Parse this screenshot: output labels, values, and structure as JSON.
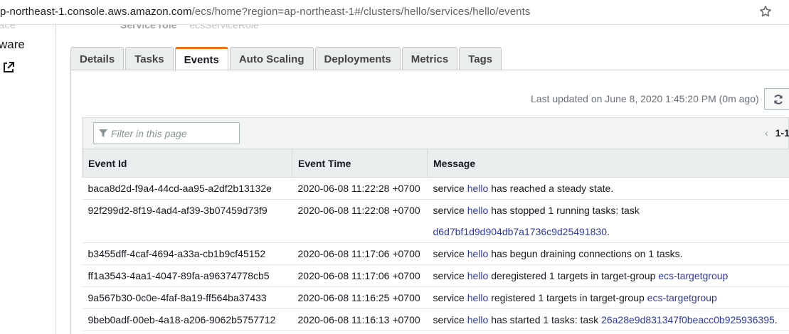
{
  "browser": {
    "url_host_partial": "p-northeast-1.console.aws.amazon.com",
    "url_rest": "/ecs/home?region=ap-northeast-1#/clusters/hello/services/hello/events"
  },
  "sidebar": {
    "faded_text": "ace",
    "ware_text": "ware"
  },
  "service_role": {
    "label": "Service role",
    "value": "ecsServiceRole"
  },
  "tabs": [
    {
      "label": "Details"
    },
    {
      "label": "Tasks"
    },
    {
      "label": "Events"
    },
    {
      "label": "Auto Scaling"
    },
    {
      "label": "Deployments"
    },
    {
      "label": "Metrics"
    },
    {
      "label": "Tags"
    }
  ],
  "active_tab": "Events",
  "last_updated": "Last updated on June 8, 2020 1:45:20 PM (0m ago)",
  "filter": {
    "placeholder": "Filter in this page"
  },
  "pager": {
    "range": "1-1"
  },
  "columns": [
    "Event Id",
    "Event Time",
    "Message"
  ],
  "rows": [
    {
      "id": "baca8d2d-f9a4-44cd-aa95-a2df2b13132e",
      "time": "2020-06-08 11:22:28 +0700",
      "msg": {
        "pre": "service ",
        "svc": "hello",
        "mid": " has reached a steady state.",
        "link": "",
        "post": "",
        "link2": ""
      }
    },
    {
      "id": "92f299d2-8f19-4ad4-af39-3b07459d73f9",
      "time": "2020-06-08 11:22:08 +0700",
      "msg": {
        "pre": "service ",
        "svc": "hello",
        "mid": " has stopped 1 running tasks: task",
        "link": "",
        "post": "",
        "link2": "d6d7bf1d9d904db7a1736c9d25491830",
        "post2": "."
      }
    },
    {
      "id": "b3455dff-4caf-4694-a33a-cb1b9cf45152",
      "time": "2020-06-08 11:17:06 +0700",
      "msg": {
        "pre": "service ",
        "svc": "hello",
        "mid": " has begun draining connections on 1 tasks.",
        "link": "",
        "post": "",
        "link2": ""
      }
    },
    {
      "id": "ff1a3543-4aa1-4047-89fa-a96374778cb5",
      "time": "2020-06-08 11:17:06 +0700",
      "msg": {
        "pre": "service ",
        "svc": "hello",
        "mid": " deregistered 1 targets in target-group ",
        "link": "ecs-targetgroup",
        "post": "",
        "link2": ""
      }
    },
    {
      "id": "9a567b30-0c0e-4faf-8a19-ff564ba37433",
      "time": "2020-06-08 11:16:25 +0700",
      "msg": {
        "pre": "service ",
        "svc": "hello",
        "mid": " registered 1 targets in target-group ",
        "link": "ecs-targetgroup",
        "post": "",
        "link2": ""
      }
    },
    {
      "id": "9beb0adf-00eb-4a18-a206-9062b5757712",
      "time": "2020-06-08 11:16:13 +0700",
      "msg": {
        "pre": "service ",
        "svc": "hello",
        "mid": " has started 1 tasks: task ",
        "link": "26a28e9d831347f0beacc0b925936395",
        "post": ".",
        "link2": ""
      }
    }
  ],
  "colors": {
    "accent": "#ec7211",
    "link": "#2d3aa8"
  },
  "icons": {
    "star": "star-icon",
    "external": "external-link-icon",
    "refresh": "refresh-icon",
    "filter": "filter-icon",
    "chevron": "chevron-left-icon"
  }
}
